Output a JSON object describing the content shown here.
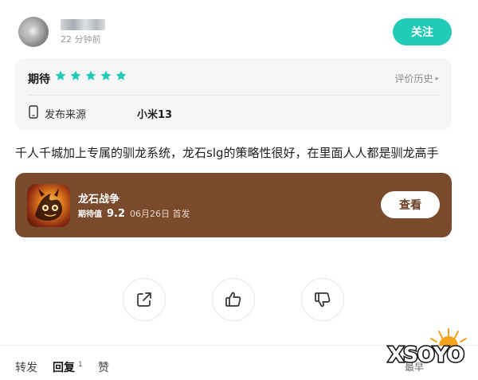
{
  "header": {
    "timestamp": "22 分钟前",
    "follow_label": "关注"
  },
  "rating": {
    "label": "期待",
    "stars": 5,
    "star_color": "#22cbb7",
    "history_label": "评价历史",
    "source_label": "发布来源",
    "device": "小米13"
  },
  "review": {
    "text": "千人千城加上专属的驯龙系统，龙石slg的策略性很好，在里面人人都是驯龙高手"
  },
  "game": {
    "name": "龙石战争",
    "score_label": "期待值",
    "score": "9.2",
    "release": "06月26日 首发",
    "view_label": "查看",
    "card_color": "#7a4a2c"
  },
  "actions": {
    "share_icon": "share-icon",
    "like_icon": "thumbs-up-icon",
    "dislike_icon": "thumbs-down-icon"
  },
  "footer": {
    "forward": "转发",
    "reply": "回复",
    "reply_count": "1",
    "like": "赞",
    "sort": "最早"
  },
  "watermark": {
    "text": "XSOYO"
  },
  "colors": {
    "accent": "#22cbb7",
    "game_card": "#7a4a2c"
  }
}
